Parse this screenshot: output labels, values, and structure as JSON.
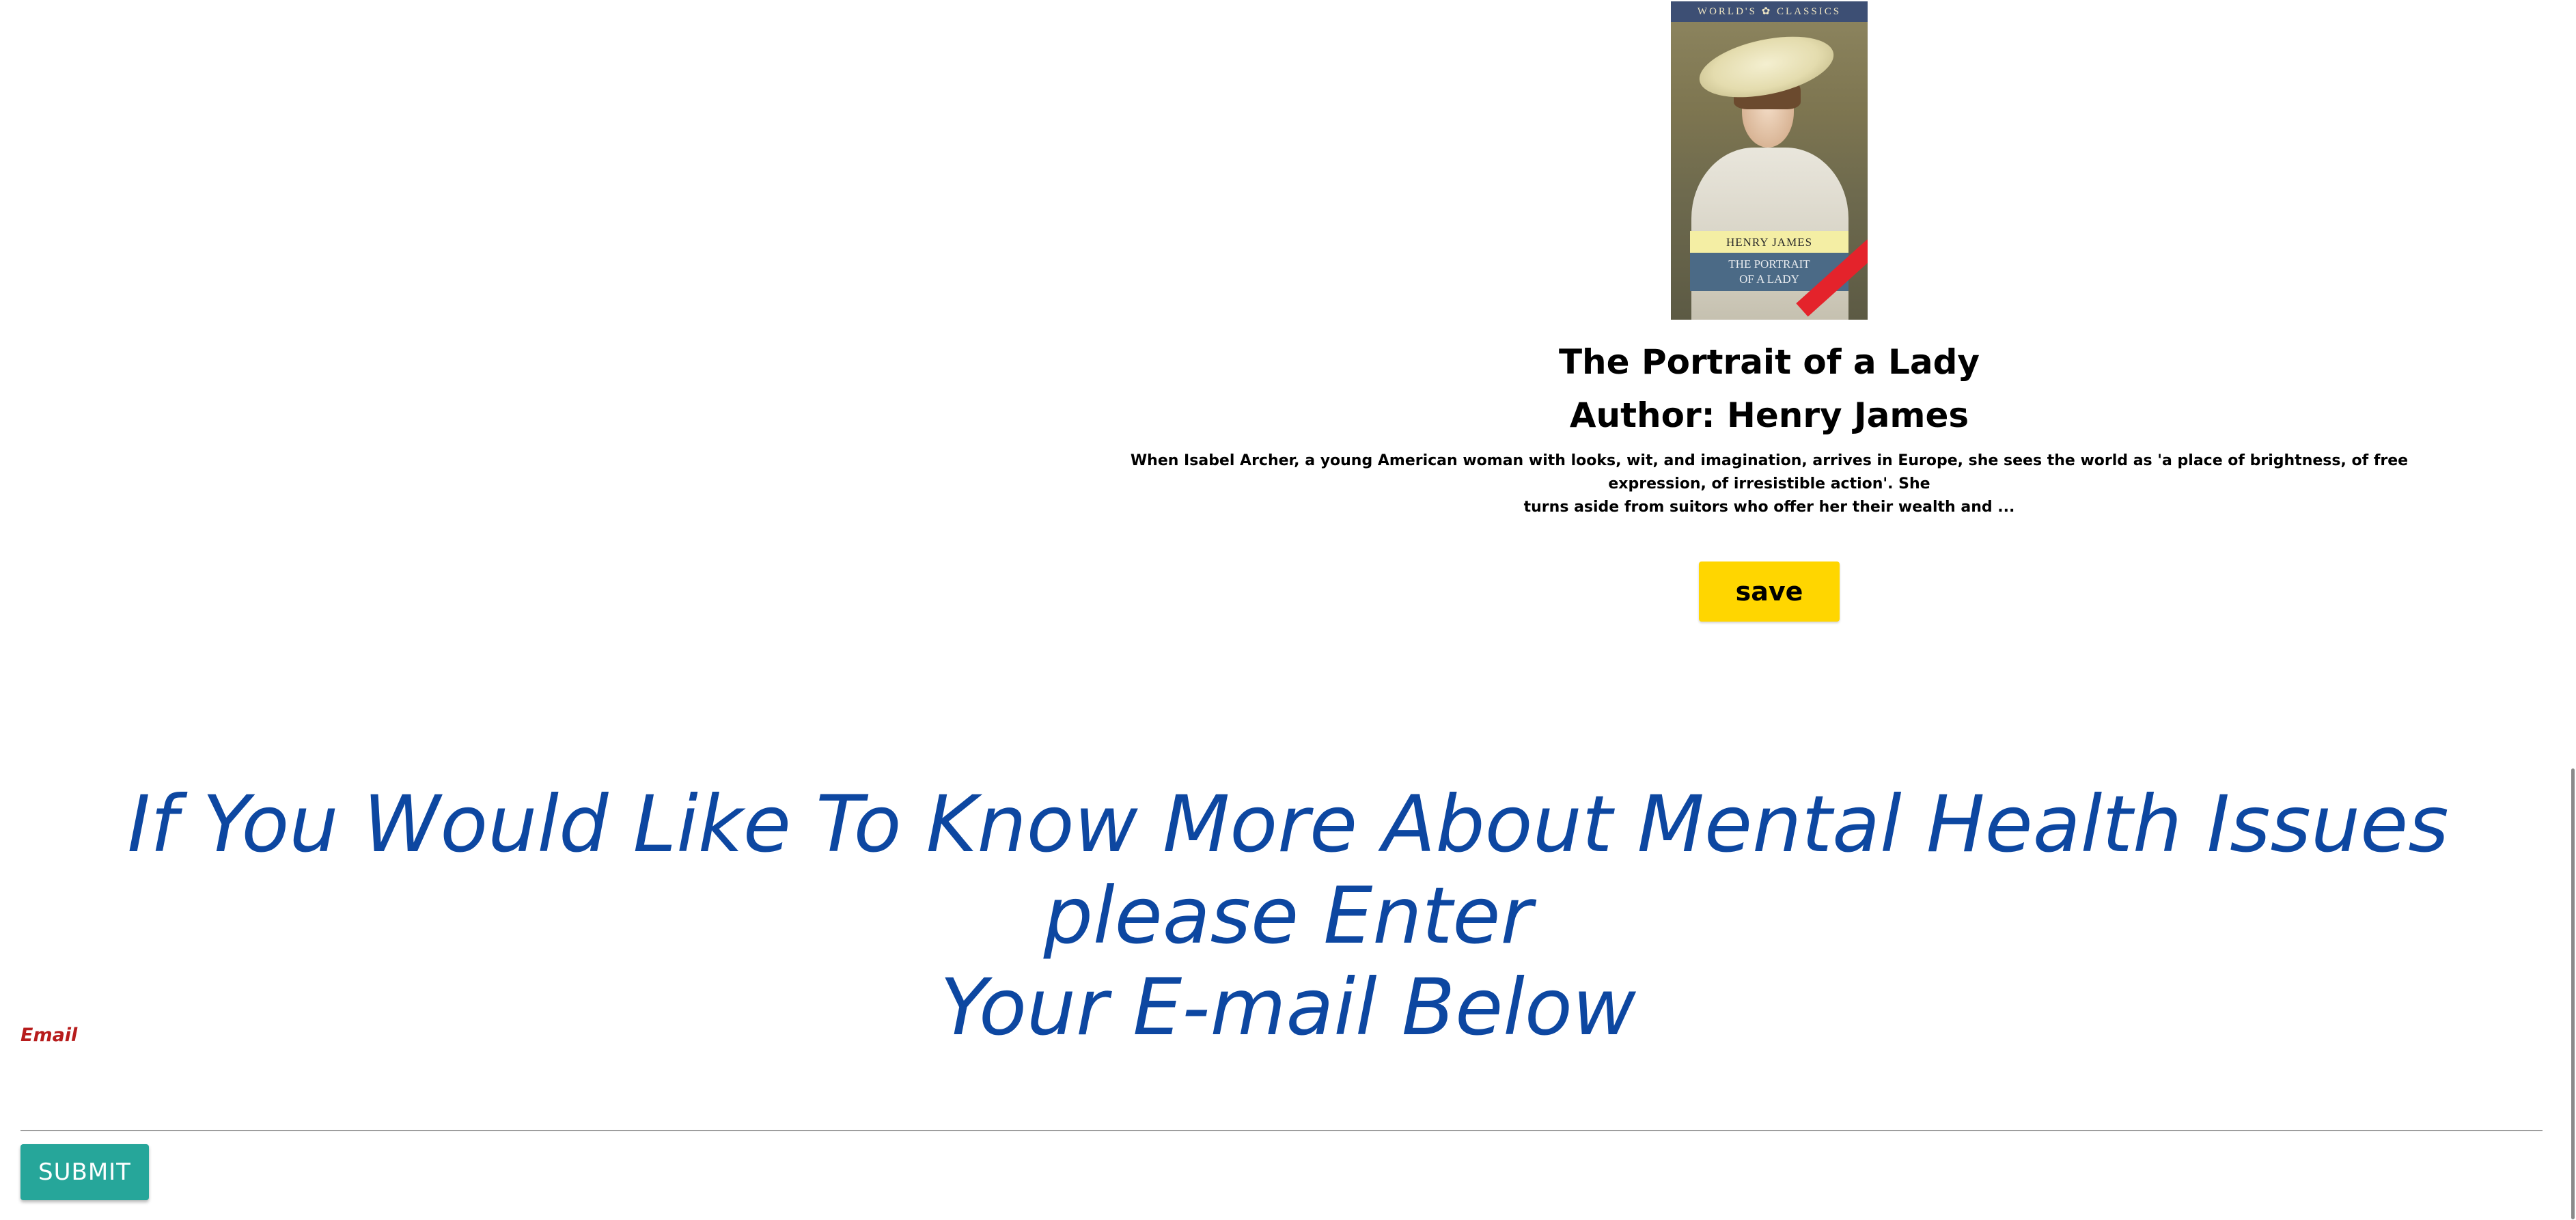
{
  "book": {
    "cover": {
      "series_banner": "WORLD'S ✿ CLASSICS",
      "author_label": "HENRY JAMES",
      "title_label_line1": "THE PORTRAIT",
      "title_label_line2": "OF A LADY"
    },
    "title": "The Portrait of a Lady",
    "author": "Author: Henry James",
    "description_line1": "When Isabel Archer, a young American woman with looks, wit, and imagination, arrives in Europe, she sees the world as 'a place of brightness, of free expression, of irresistible action'. She",
    "description_line2": "turns aside from suitors who offer her their wealth and ...",
    "save_label": "save"
  },
  "newsletter": {
    "heading_line1": "If You Would Like To Know More About Mental Health Issues please Enter",
    "heading_line2": "Your E-mail Below",
    "email_label": "Email",
    "email_value": "",
    "submit_label": "SUBMIT"
  },
  "colors": {
    "heading": "#0d47a1",
    "email_label": "#b71c1c",
    "save_button": "#ffd600",
    "submit_button": "#26a69a"
  }
}
